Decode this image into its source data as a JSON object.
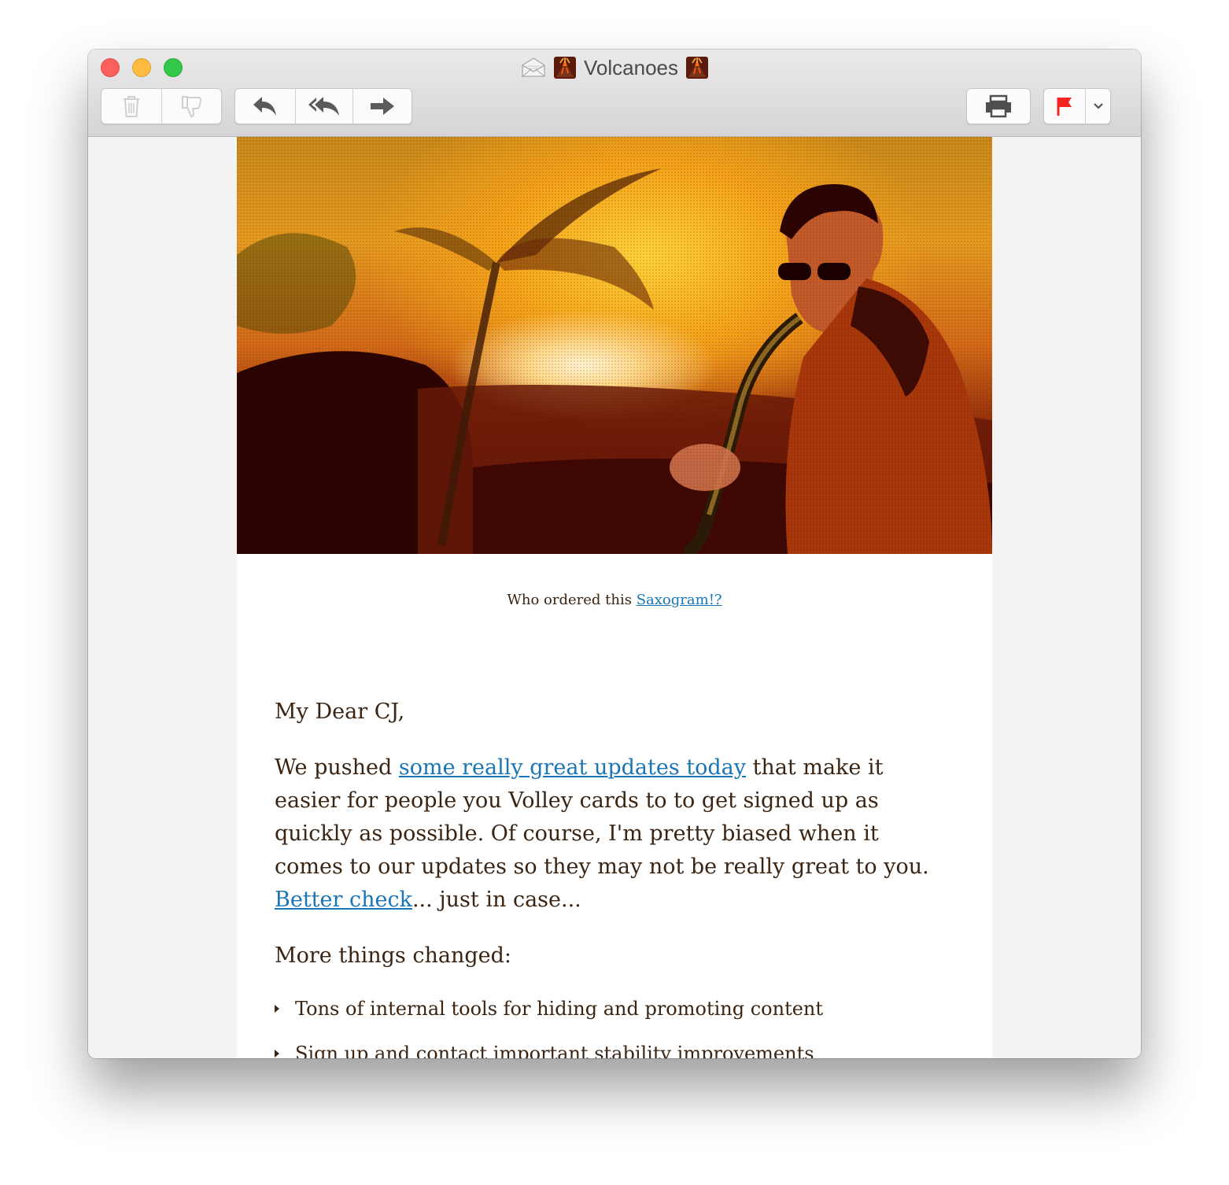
{
  "window": {
    "title": "Volcanoes"
  },
  "colors": {
    "close": "#fc605c",
    "minimize": "#fdbc40",
    "zoom": "#34c84a",
    "flag": "#f2251f",
    "link": "#1a75b5",
    "body_text": "#3b2412"
  },
  "toolbar": {
    "icons": [
      "trash-icon",
      "junk-icon",
      "reply-icon",
      "reply-all-icon",
      "forward-icon",
      "print-icon",
      "flag-icon",
      "chevron-down-icon"
    ]
  },
  "email": {
    "caption_prefix": "Who ordered this ",
    "caption_link": "Saxogram!?",
    "greeting": "My Dear CJ,",
    "para1_start": "We pushed ",
    "para1_link": "some really great updates today",
    "para1_middle": " that make it easier for people you Volley cards to to get signed up as quickly as possible. Of course, I'm pretty biased when it comes to our updates so they may not be really great to you. ",
    "para1_link2": "Better check",
    "para1_end": "... just in case...",
    "more_heading": "More things changed:",
    "changes": [
      "Tons of internal tools for hiding and promoting content",
      "Sign up and contact important stability improvements"
    ]
  }
}
